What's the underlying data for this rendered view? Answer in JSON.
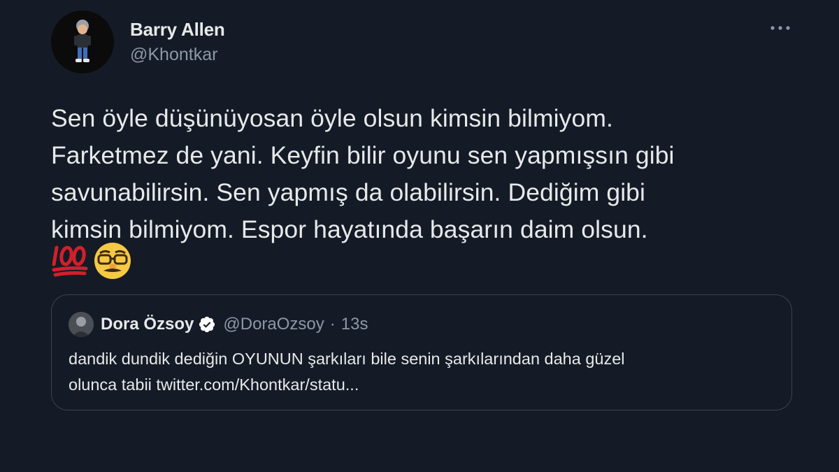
{
  "tweet": {
    "author": {
      "display_name": "Barry Allen",
      "handle": "@Khontkar",
      "avatar_icon": "cartoon-character-avatar"
    },
    "more_icon": "more-horizontal-icon",
    "text_lines": [
      "Sen öyle düşünüyosan öyle olsun kimsin bilmiyom.",
      "Farketmez de yani. Keyfin bilir oyunu sen yapmışsın gibi",
      "savunabilirsin. Sen yapmış da olabilirsin. Dediğim gibi",
      "kimsin bilmiyom. Espor hayatında başarın daim olsun."
    ],
    "emojis": [
      "hundred-points-emoji",
      "disguised-face-emoji"
    ]
  },
  "quoted_tweet": {
    "author": {
      "display_name": "Dora Özsoy",
      "handle": "@DoraOzsoy",
      "verified": true,
      "avatar_icon": "profile-photo-avatar"
    },
    "separator": "·",
    "time": "13s",
    "text_lines": [
      "dandik dundik dediğin OYUNUN şarkıları bile senin şarkılarından daha güzel",
      "olunca tabii twitter.com/Khontkar/statu..."
    ]
  },
  "colors": {
    "background": "#151b26",
    "primary_text": "#e7e9ea",
    "secondary_text": "#8b98a5",
    "border": "#38444d",
    "verified_badge": "#ffffff"
  }
}
